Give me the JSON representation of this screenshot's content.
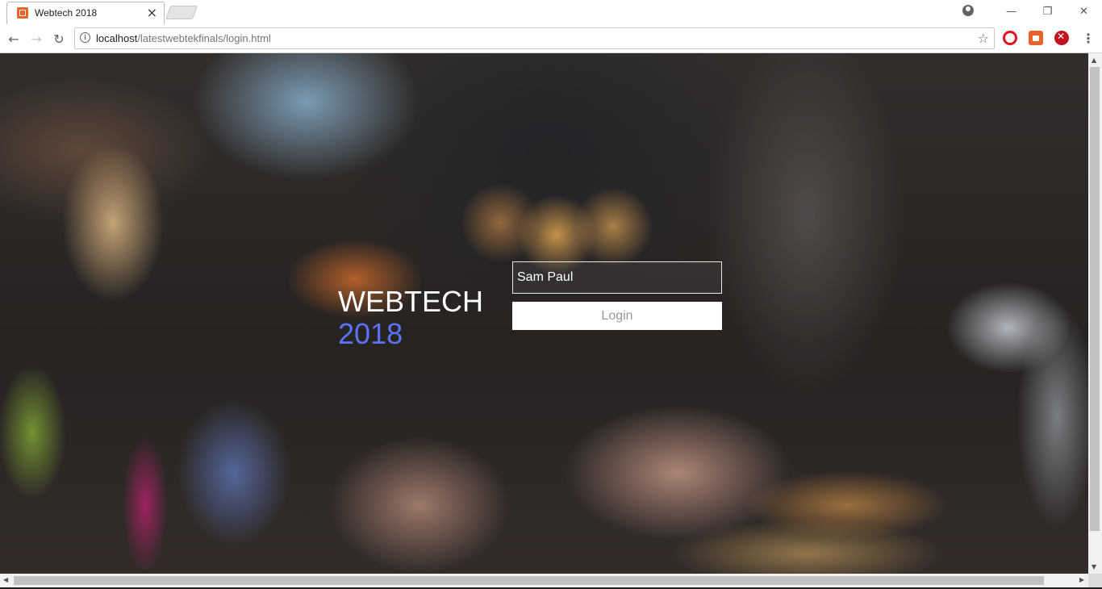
{
  "browser": {
    "tab_title": "Webtech 2018",
    "tab_close": "×",
    "url_host": "localhost",
    "url_path": "/latestwebtekfinals/login.html",
    "window_controls": {
      "minimize": "—",
      "restore": "❐",
      "close": "✕"
    },
    "icons": {
      "back": "←",
      "forward": "→",
      "reload": "↻",
      "info": "i",
      "star": "☆",
      "menu": "⋮"
    },
    "extensions": [
      "opera-icon",
      "lock-extension-icon",
      "block-extension-icon"
    ]
  },
  "page": {
    "brand_line1": "WEBTECH",
    "brand_line2": "2018",
    "brand_accent_color": "#5b73f5",
    "username_value": "Sam Paul",
    "login_label": "Login"
  }
}
